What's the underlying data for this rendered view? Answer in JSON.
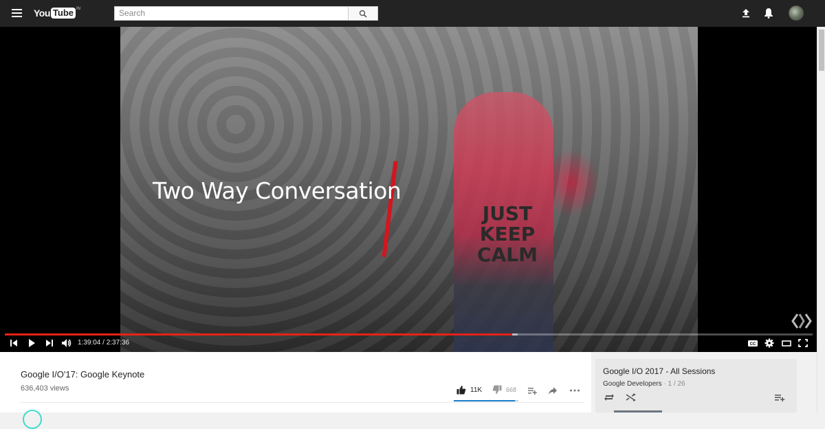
{
  "header": {
    "logo_you": "You",
    "logo_tube": "Tube",
    "logo_region": "IN",
    "search_placeholder": "Search"
  },
  "player": {
    "overlay_text": "Two Way Conversation",
    "shirt_text": "JUST KEEP CALM",
    "time_current": "1:39:04",
    "time_separator": " / ",
    "time_total": "2:37:36",
    "progress_played": 0.628,
    "progress_loaded": 0.635,
    "accent": "#e62117"
  },
  "video": {
    "title": "Google I/O'17: Google Keynote",
    "views": "636,403 views",
    "likes": "11K",
    "dislikes": "668",
    "like_ratio": 0.943
  },
  "playlist": {
    "title": "Google I/O 2017 - All Sessions",
    "channel": "Google Developers",
    "separator": " · ",
    "position": "1 / 26"
  },
  "icons": [
    "menu-icon",
    "search-icon",
    "upload-icon",
    "bell-icon",
    "skip-back-icon",
    "play-icon",
    "skip-next-icon",
    "volume-icon",
    "captions-icon",
    "settings-icon",
    "theater-icon",
    "fullscreen-icon",
    "thumbs-up-icon",
    "thumbs-down-icon",
    "add-to-icon",
    "share-icon",
    "more-icon",
    "loop-icon",
    "shuffle-icon",
    "playlist-add-icon"
  ]
}
